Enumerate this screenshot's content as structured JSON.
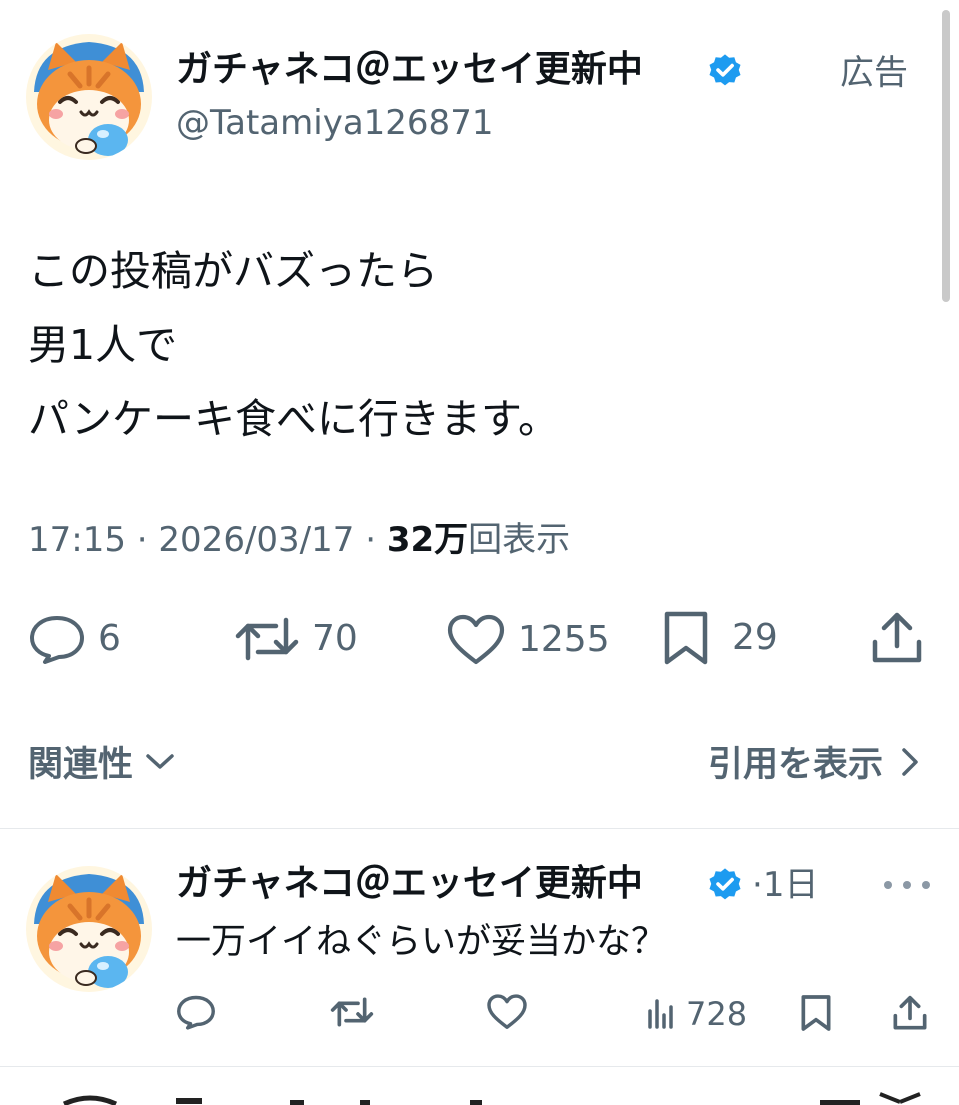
{
  "post": {
    "author_name": "ガチャネコ＠エッセイ更新中",
    "handle": "@Tatamiya126871",
    "ad_label": "広告",
    "body_lines": [
      "この投稿がバズったら",
      "男1人で",
      "パンケーキ食べに行きます。"
    ],
    "time": "17:15",
    "date": "2026/03/17",
    "separator": "·",
    "views_count": "32万",
    "views_label": "回表示",
    "actions": {
      "replies": "6",
      "reposts": "70",
      "likes": "1255",
      "bookmarks": "29"
    },
    "related_label": "関連性",
    "quotes_label": "引用を表示"
  },
  "reply": {
    "author_name": "ガチャネコ＠エッセイ更新中",
    "time": "1日",
    "separator": "·",
    "text": "一万イイねぐらいが妥当かな？",
    "views": "728"
  },
  "icons": {
    "verified": "verified-badge-icon",
    "reply": "reply-icon",
    "repost": "repost-icon",
    "like": "heart-icon",
    "bookmark": "bookmark-icon",
    "share": "share-icon",
    "views": "analytics-icon",
    "more": "more-icon",
    "chevron_down": "chevron-down-icon",
    "chevron_right": "chevron-right-icon"
  },
  "colors": {
    "verified_blue": "#1d9bf0",
    "text_primary": "#0f1419",
    "text_secondary": "#536471"
  }
}
